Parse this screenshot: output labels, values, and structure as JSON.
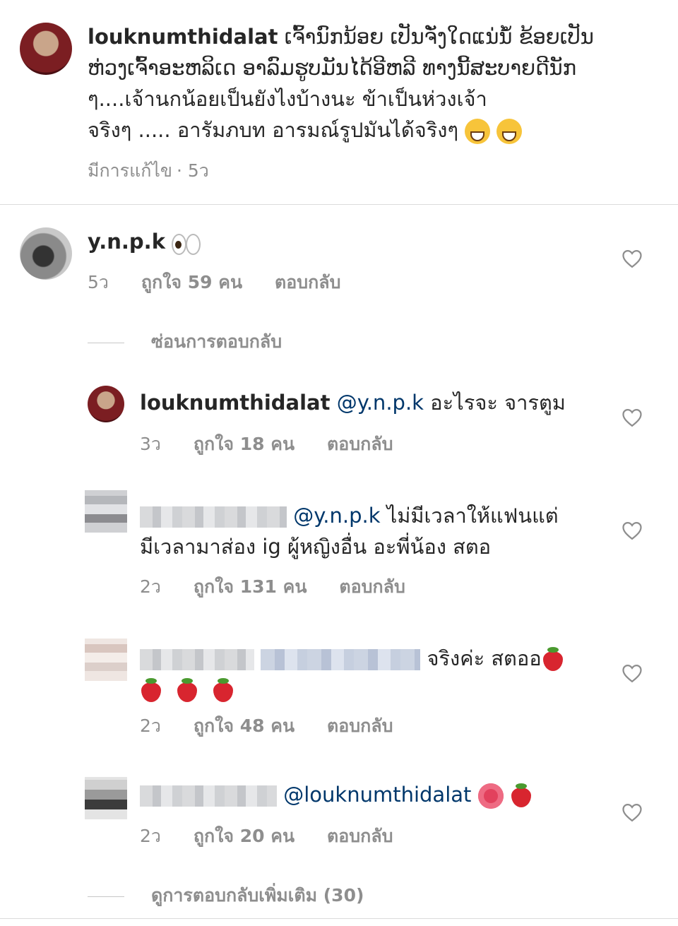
{
  "post": {
    "username": "louknumthidalat",
    "caption_lines": [
      "ເຈົ້ານົກນ້ອຍ ເປັນຈັ່ງໃດແນ່ນໍ້ ຂ້ອຍເປັນ",
      "ຫ່ວງເຈົ້າອະຫລິເດ ອາລົມຮູບມັນໄດ້ອີຫລີ ທາງນີ້ສະບາຍດີນັກ",
      "ๆ....เจ้านกน้อยเป็นยังไงบ้างนะ ข้าเป็นห่วงเจ้า",
      "จริงๆ ..... อารัมภบท อารมณ์รูปมันได้จริงๆ"
    ],
    "edited_label": "มีการแก้ไข",
    "time": "5ว"
  },
  "comments": [
    {
      "username": "y.n.p.k",
      "time": "5ว",
      "likes": "ถูกใจ 59 คน",
      "reply": "ตอบกลับ"
    }
  ],
  "hide_replies_label": "ซ่อนการตอบกลับ",
  "replies": [
    {
      "username": "louknumthidalat",
      "mention": "@y.n.p.k",
      "text": "อะไรจะ จารตูม",
      "time": "3ว",
      "likes": "ถูกใจ 18 คน",
      "reply": "ตอบกลับ"
    },
    {
      "mention": "@y.n.p.k",
      "text_line1": "ไม่มีเวลาให้แฟนแต่",
      "text_line2": "มีเวลามาส่อง ig ผู้หญิงอื่น อะพี่น้อง สตอ",
      "time": "2ว",
      "likes": "ถูกใจ 131 คน",
      "reply": "ตอบกลับ"
    },
    {
      "text": "จริงค่ะ สตออ",
      "time": "2ว",
      "likes": "ถูกใจ 48 คน",
      "reply": "ตอบกลับ"
    },
    {
      "mention": "@louknumthidalat",
      "time": "2ว",
      "likes": "ถูกใจ 20 คน",
      "reply": "ตอบกลับ"
    }
  ],
  "view_more_label": "ดูการตอบกลับเพิ่มเติม (30)",
  "colors": {
    "mention": "#00376b",
    "meta": "#8e8e8e",
    "divider": "#dbdbdb"
  },
  "icons": [
    "heart-icon",
    "grinning-emoji",
    "strawberry-emoji",
    "hibiscus-emoji",
    "eyes-emoji"
  ]
}
